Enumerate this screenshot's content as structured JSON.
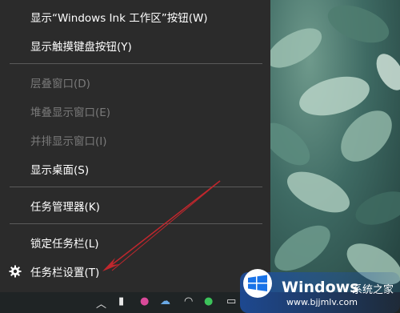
{
  "menu": {
    "items": [
      {
        "label": "显示“Windows Ink 工作区”按钮(W)",
        "enabled": true
      },
      {
        "label": "显示触摸键盘按钮(Y)",
        "enabled": true
      },
      {
        "label": "层叠窗口(D)",
        "enabled": false
      },
      {
        "label": "堆叠显示窗口(E)",
        "enabled": false
      },
      {
        "label": "并排显示窗口(I)",
        "enabled": false
      },
      {
        "label": "显示桌面(S)",
        "enabled": true
      },
      {
        "label": "任务管理器(K)",
        "enabled": true
      },
      {
        "label": "锁定任务栏(L)",
        "enabled": true
      },
      {
        "label": "任务栏设置(T)",
        "enabled": true,
        "icon": "gear-icon"
      }
    ]
  },
  "watermark": {
    "brand": "Windows",
    "subtitle": "系统之家",
    "url": "www.bjjmlv.com"
  },
  "colors": {
    "menu_bg": "#2b2b2b",
    "text": "#ffffff",
    "disabled_text": "#7a7a7a",
    "separator": "#5a5a5a",
    "arrow": "#c0272d",
    "logo_blue": "#1a73e8"
  }
}
